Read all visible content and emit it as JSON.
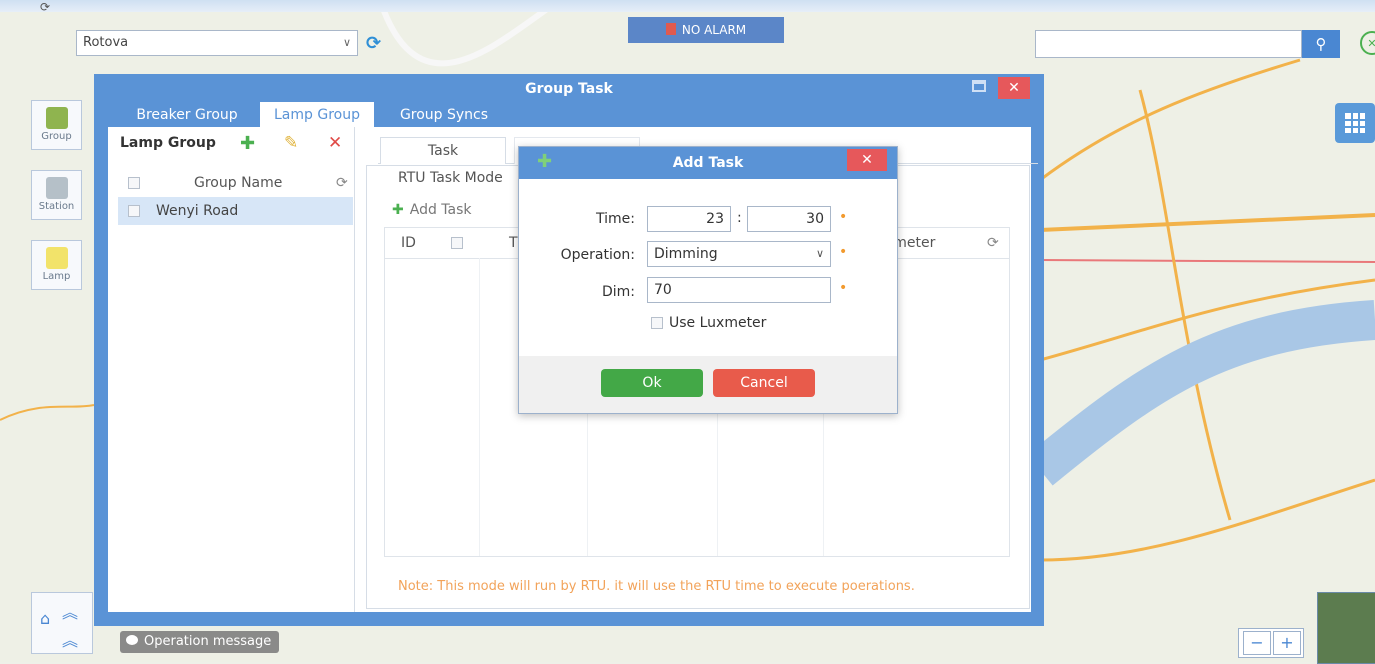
{
  "toolbar": {
    "station_value": "Rotova",
    "alarm_text": "NO ALARM",
    "search_placeholder": ""
  },
  "sidebar": {
    "items": [
      {
        "label": "Group"
      },
      {
        "label": "Station"
      },
      {
        "label": "Lamp"
      }
    ]
  },
  "status": {
    "operation_message": "Operation message"
  },
  "group_task": {
    "title": "Group Task",
    "tabs": [
      "Breaker Group",
      "Lamp Group",
      "Group Syncs"
    ],
    "active_tab": "Lamp Group",
    "lamp_group": {
      "title": "Lamp Group",
      "column_header": "Group Name",
      "rows": [
        "Wenyi Road"
      ]
    },
    "task": {
      "tabs": [
        "Task"
      ],
      "mode_label": "RTU Task Mode",
      "add_task_label": "Add Task",
      "columns": [
        "ID",
        "T",
        "xmeter"
      ],
      "note": "Note: This mode will run by RTU. it will use the RTU time to execute poerations."
    }
  },
  "add_task": {
    "title": "Add Task",
    "time_label": "Time:",
    "hour": "23",
    "minute": "30",
    "time_sep": ":",
    "operation_label": "Operation:",
    "operation_value": "Dimming",
    "dim_label": "Dim:",
    "dim_value": "70",
    "use_luxmeter_label": "Use Luxmeter",
    "ok_label": "Ok",
    "cancel_label": "Cancel"
  },
  "colors": {
    "window_blue": "#5a93d6",
    "ok_green": "#43a847",
    "cancel_red": "#e85b4b",
    "note_orange": "#f2a35a"
  }
}
